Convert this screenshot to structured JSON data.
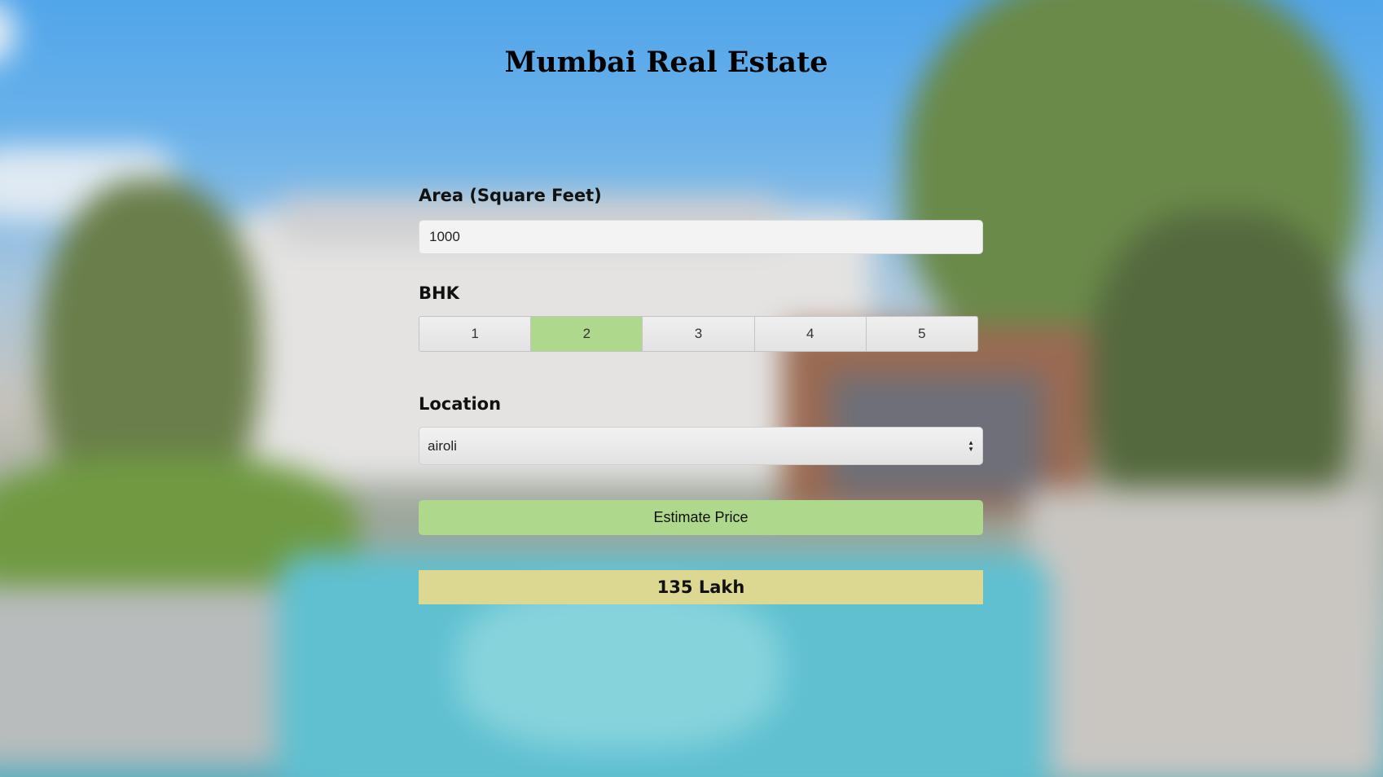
{
  "page": {
    "title": "Mumbai Real Estate"
  },
  "form": {
    "area": {
      "label": "Area (Square Feet)",
      "value": "1000"
    },
    "bhk": {
      "label": "BHK",
      "options": [
        "1",
        "2",
        "3",
        "4",
        "5"
      ],
      "selected": "2"
    },
    "location": {
      "label": "Location",
      "selected_value": "airoli"
    },
    "estimate_button_label": "Estimate Price",
    "result": "135 Lakh"
  },
  "colors": {
    "accent_green": "#aed88c",
    "result_yellow": "#ddd891"
  },
  "background": {
    "icon": "blurred-house-with-pool-image"
  }
}
